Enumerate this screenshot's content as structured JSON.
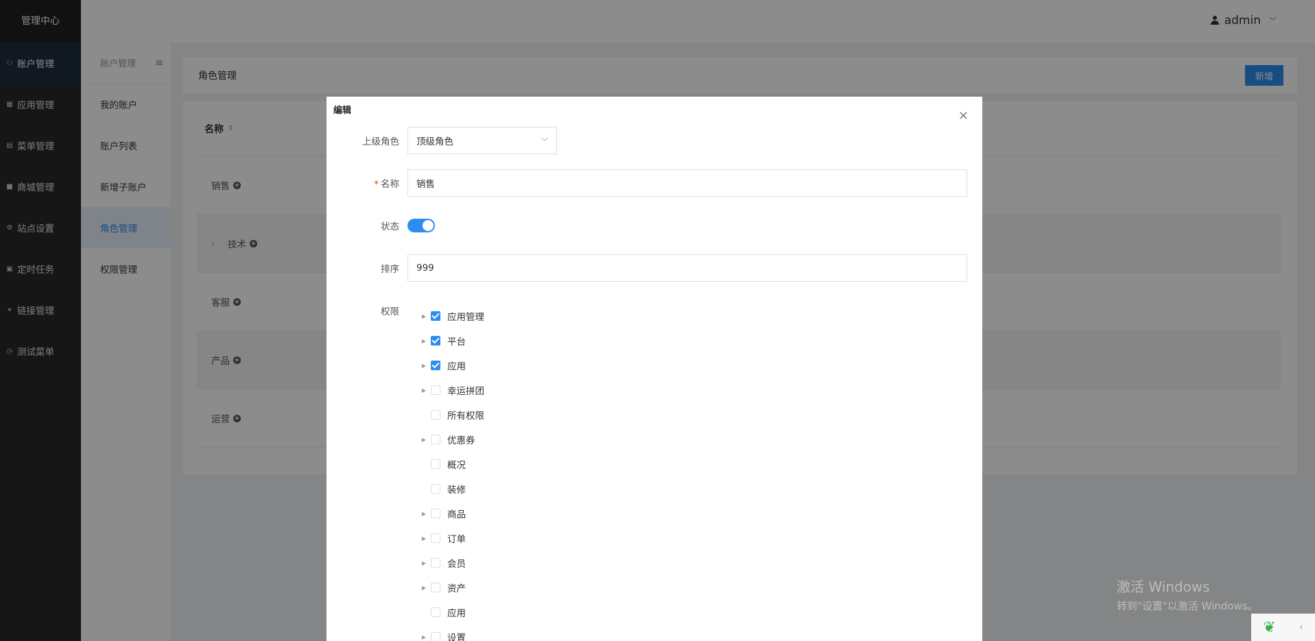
{
  "sidebar": {
    "brand": "管理中心",
    "items": [
      {
        "label": "账户管理",
        "icon": "user-icon",
        "glyph": "⚇"
      },
      {
        "label": "应用管理",
        "icon": "grid-icon",
        "glyph": "▦"
      },
      {
        "label": "菜单管理",
        "icon": "document-icon",
        "glyph": "▤"
      },
      {
        "label": "商城管理",
        "icon": "shop-icon",
        "glyph": "■"
      },
      {
        "label": "站点设置",
        "icon": "gear-icon",
        "glyph": "⚙"
      },
      {
        "label": "定时任务",
        "icon": "calendar-icon",
        "glyph": "▣"
      },
      {
        "label": "链接管理",
        "icon": "link-icon",
        "glyph": "⚭"
      },
      {
        "label": "测试菜单",
        "icon": "clock-icon",
        "glyph": "◷"
      }
    ]
  },
  "submenu": {
    "heading": "账户管理",
    "items": [
      "我的账户",
      "账户列表",
      "新增子账户",
      "角色管理",
      "权限管理"
    ]
  },
  "header": {
    "user": "admin"
  },
  "page": {
    "title": "角色管理",
    "add_label": "新增",
    "column_name": "名称",
    "rows": [
      "销售",
      "技术",
      "客服",
      "产品",
      "运营"
    ]
  },
  "modal": {
    "title": "编辑",
    "parent_role_label": "上级角色",
    "parent_role_value": "顶级角色",
    "name_label": "名称",
    "name_value": "销售",
    "status_label": "状态",
    "status_on": true,
    "sort_label": "排序",
    "sort_value": "999",
    "perm_label": "权限",
    "permissions": [
      {
        "label": "应用管理",
        "checked": true,
        "expandable": true
      },
      {
        "label": "平台",
        "checked": true,
        "expandable": true
      },
      {
        "label": "应用",
        "checked": true,
        "expandable": true
      },
      {
        "label": "幸运拼团",
        "checked": false,
        "expandable": true
      },
      {
        "label": "所有权限",
        "checked": false,
        "expandable": false
      },
      {
        "label": "优惠券",
        "checked": false,
        "expandable": true
      },
      {
        "label": "概况",
        "checked": false,
        "expandable": false
      },
      {
        "label": "装修",
        "checked": false,
        "expandable": false
      },
      {
        "label": "商品",
        "checked": false,
        "expandable": true
      },
      {
        "label": "订单",
        "checked": false,
        "expandable": true
      },
      {
        "label": "会员",
        "checked": false,
        "expandable": true
      },
      {
        "label": "资产",
        "checked": false,
        "expandable": true
      },
      {
        "label": "应用",
        "checked": false,
        "expandable": false
      },
      {
        "label": "设置",
        "checked": false,
        "expandable": true
      }
    ]
  },
  "watermark": {
    "line1": "激活 Windows",
    "line2": "转到\"设置\"以激活 Windows。"
  },
  "colors": {
    "primary": "#2d8cf0",
    "sidebar": "#282828",
    "required": "#ed4014"
  }
}
